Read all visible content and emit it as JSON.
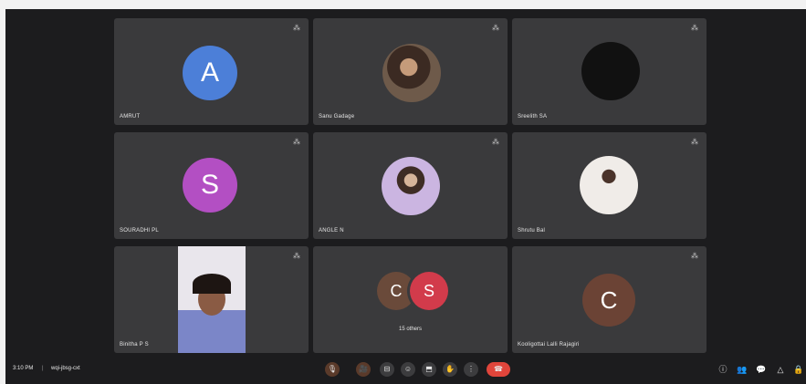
{
  "meeting": {
    "time": "3:10 PM",
    "separator": "|",
    "code": "wqi-jbsg-cxt"
  },
  "tiles": [
    {
      "name": "AMRUT",
      "initial": "A",
      "avatar_color": "#4c7fd8"
    },
    {
      "name": "Sanu Gadage",
      "type": "photo"
    },
    {
      "name": "Sreelith SA",
      "type": "dark-photo"
    },
    {
      "name": "SOURADHI PL",
      "initial": "S",
      "avatar_color": "#b34fc3"
    },
    {
      "name": "ANGLE N",
      "type": "photo"
    },
    {
      "name": "Shrutu Bal",
      "type": "photo"
    },
    {
      "name": "Binitha P S",
      "type": "video"
    },
    {
      "name": "15 others",
      "others_initials": [
        "C",
        "S"
      ],
      "others_colors": [
        "#6a4a3a",
        "#d23b4b"
      ]
    },
    {
      "name": "Kooligottai Lalli Rajagiri",
      "initial": "C",
      "avatar_color": "#6b4335"
    }
  ],
  "controls": {
    "items": [
      "mic",
      "camera",
      "captions",
      "emoji",
      "present",
      "raise-hand",
      "more",
      "end-call"
    ],
    "end_call_color": "#e0453b"
  },
  "right_controls": [
    "info",
    "people",
    "chat",
    "activities",
    "lock"
  ]
}
